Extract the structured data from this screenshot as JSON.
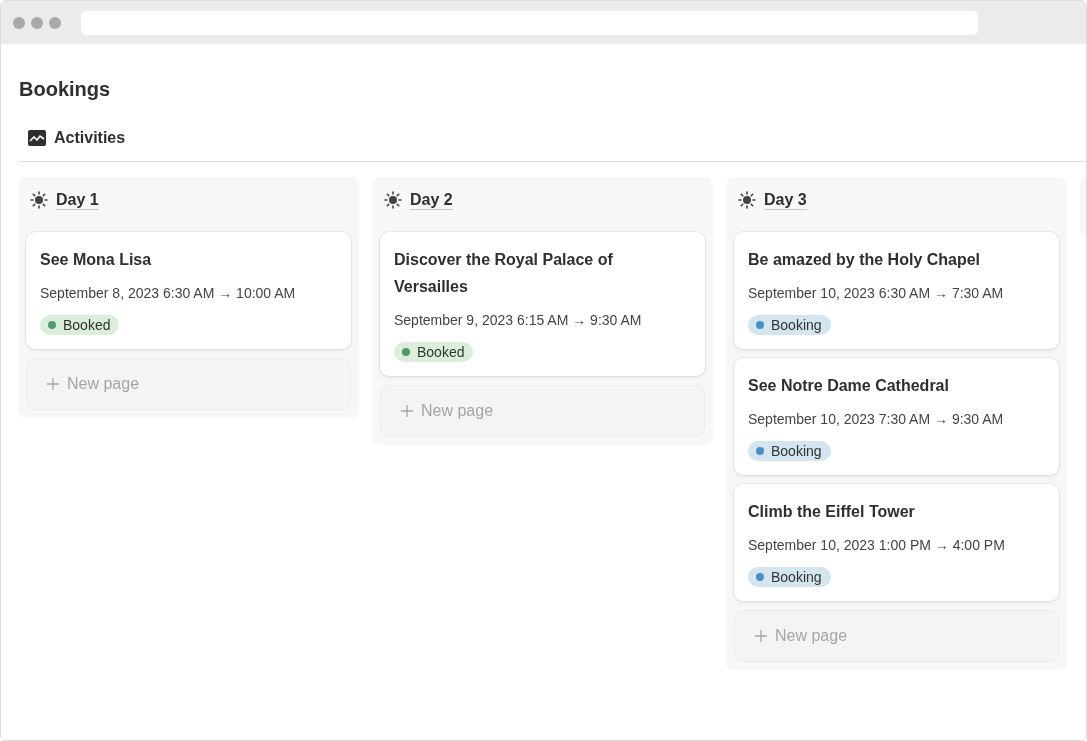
{
  "page": {
    "title": "Bookings"
  },
  "view": {
    "label": "Activities",
    "selected": true
  },
  "columns": [
    {
      "title": "Day 1",
      "cards": [
        {
          "title": "See Mona Lisa",
          "date": "September 8, 2023 6:30 AM → 10:00 AM",
          "status": {
            "label": "Booked",
            "kind": "booked",
            "color": "#4f9a6e"
          }
        }
      ],
      "new_label": "New page"
    },
    {
      "title": "Day 2",
      "cards": [
        {
          "title": "Discover the Royal Palace of Versailles",
          "date": "September 9, 2023 6:15 AM → 9:30 AM",
          "status": {
            "label": "Booked",
            "kind": "booked",
            "color": "#4f9a6e"
          }
        }
      ],
      "new_label": "New page"
    },
    {
      "title": "Day 3",
      "cards": [
        {
          "title": "Be amazed by the Holy Chapel",
          "date": "September 10, 2023 6:30 AM → 7:30 AM",
          "status": {
            "label": "Booking",
            "kind": "booking",
            "color": "#4a90c2"
          }
        },
        {
          "title": "See Notre Dame Cathedral",
          "date": "September 10, 2023 7:30 AM → 9:30 AM",
          "status": {
            "label": "Booking",
            "kind": "booking",
            "color": "#4a90c2"
          }
        },
        {
          "title": "Climb the Eiffel Tower",
          "date": "September 10, 2023 1:00 PM → 4:00 PM",
          "status": {
            "label": "Booking",
            "kind": "booking",
            "color": "#4a90c2"
          }
        }
      ],
      "new_label": "New page"
    }
  ]
}
